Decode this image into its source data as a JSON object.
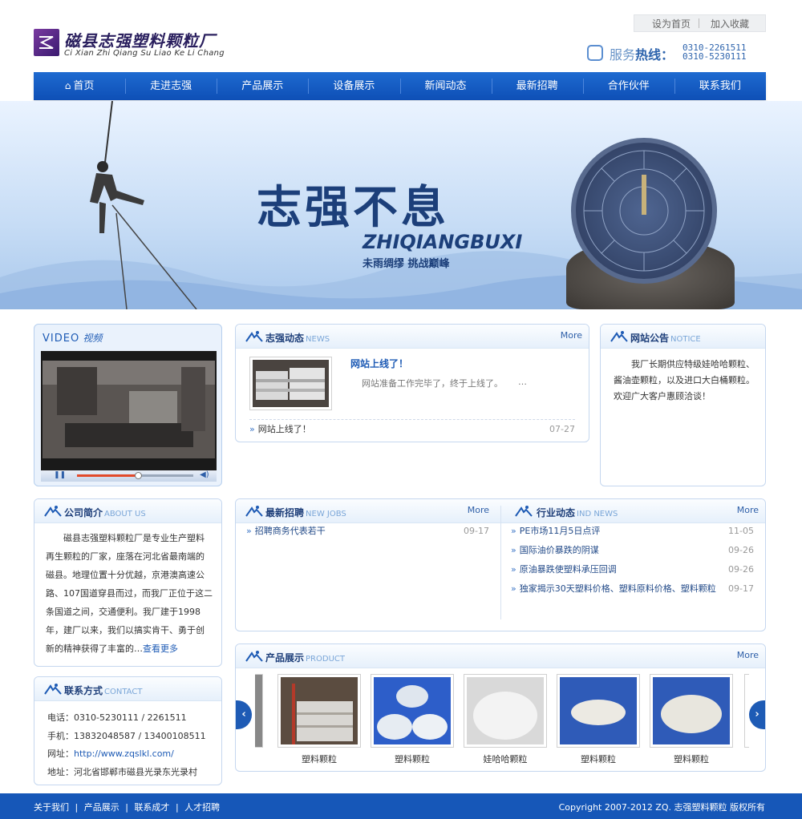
{
  "header": {
    "top_links": [
      "设为首页",
      "加入收藏"
    ],
    "logo_cn": "磁县志强塑料颗粒厂",
    "logo_en": "Ci Xian Zhi Qiang Su Liao Ke Li Chang",
    "hotline_label_a": "服务",
    "hotline_label_b": "热线：",
    "phones": [
      "0310-2261511",
      "0310-5230111"
    ]
  },
  "nav": [
    "首页",
    "走进志强",
    "产品展示",
    "设备展示",
    "新闻动态",
    "最新招聘",
    "合作伙伴",
    "联系我们"
  ],
  "banner": {
    "slogan": "志强不息",
    "slogan_en": "ZHIQIANGBUXI",
    "slogan_sub": "未雨绸缪 挑战巅峰"
  },
  "video": {
    "title_en": "VIDEO",
    "title_cn": "视频"
  },
  "news": {
    "title": "志强动态",
    "title_en": "NEWS",
    "more": "More",
    "headline": "网站上线了！",
    "summary": "网站准备工作完毕了，终于上线了。",
    "ellipsis": "…",
    "items": [
      {
        "text": "网站上线了！",
        "date": "07-27"
      }
    ]
  },
  "notice": {
    "title": "网站公告",
    "title_en": "NOTICE",
    "body": "我厂长期供应特级娃哈哈颗粒、酱油壶颗粒，以及进口大白桶颗粒。欢迎广大客户惠顾洽谈！"
  },
  "about": {
    "title": "公司简介",
    "title_en": "ABOUT US",
    "body": "磁县志强塑料颗粒厂是专业生产塑料再生颗粒的厂家，座落在河北省最南端的磁县。地理位置十分优越，京港澳高速公路、107国道穿县而过，而我厂正位于这二条国道之间，交通便利。我厂建于1998年，建厂以来，我们以搞实肯干、勇于创新的精神获得了丰富的…",
    "more_link": "查看更多"
  },
  "jobs": {
    "title": "最新招聘",
    "title_en": "NEW JOBS",
    "more": "More",
    "items": [
      {
        "text": "招聘商务代表若干",
        "date": "09-17"
      }
    ]
  },
  "industry": {
    "title": "行业动态",
    "title_en": "IND NEWS",
    "more": "More",
    "items": [
      {
        "text": "PE市场11月5日点评",
        "date": "11-05"
      },
      {
        "text": "国际油价暴跌的阴谋",
        "date": "09-26"
      },
      {
        "text": "原油暴跌使塑料承压回调",
        "date": "09-26"
      },
      {
        "text": "独家揭示30天塑料价格、塑料原料价格、塑料颗粒",
        "date": "09-17"
      }
    ]
  },
  "contact": {
    "title": "联系方式",
    "title_en": "CONTACT",
    "lines": [
      {
        "label": "电话：",
        "value": "0310-5230111 / 2261511"
      },
      {
        "label": "手机：",
        "value": "13832048587 / 13400108511"
      },
      {
        "label": "网址：",
        "value": "http://www.zqslkl.com/"
      },
      {
        "label": "地址：",
        "value": "河北省邯郸市磁县光录东光录村"
      }
    ]
  },
  "products": {
    "title": "产品展示",
    "title_en": "PRODUCT",
    "more": "More",
    "items": [
      "塑料颗粒",
      "塑料颗粒",
      "娃哈哈颗粒",
      "塑料颗粒",
      "塑料颗粒"
    ]
  },
  "footer": {
    "links": [
      "关于我们",
      "产品展示",
      "联系成才",
      "人才招聘"
    ],
    "copyright": "Copyright 2007-2012 ZQ. 志强塑料颗粒 版权所有"
  },
  "colors": {
    "brand_blue": "#0e4fb6",
    "panel_border": "#c5d7ef",
    "footer": "#1657b8"
  }
}
